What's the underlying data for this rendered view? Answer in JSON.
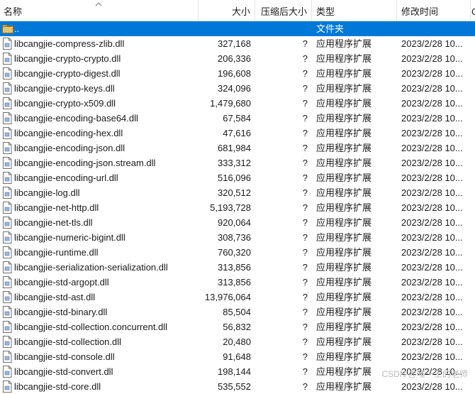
{
  "columns": {
    "name": "名称",
    "size": "大小",
    "packed": "压缩后大小",
    "type": "类型",
    "modified": "修改时间",
    "extra": "C"
  },
  "parent": {
    "name": "..",
    "type": "文件夹"
  },
  "files": [
    {
      "name": "libcangjie-compress-zlib.dll",
      "size": "327,168",
      "packed": "?",
      "type": "应用程序扩展",
      "modified": "2023/2/28 10..."
    },
    {
      "name": "libcangjie-crypto-crypto.dll",
      "size": "206,336",
      "packed": "?",
      "type": "应用程序扩展",
      "modified": "2023/2/28 10..."
    },
    {
      "name": "libcangjie-crypto-digest.dll",
      "size": "196,608",
      "packed": "?",
      "type": "应用程序扩展",
      "modified": "2023/2/28 10..."
    },
    {
      "name": "libcangjie-crypto-keys.dll",
      "size": "324,096",
      "packed": "?",
      "type": "应用程序扩展",
      "modified": "2023/2/28 10..."
    },
    {
      "name": "libcangjie-crypto-x509.dll",
      "size": "1,479,680",
      "packed": "?",
      "type": "应用程序扩展",
      "modified": "2023/2/28 10..."
    },
    {
      "name": "libcangjie-encoding-base64.dll",
      "size": "67,584",
      "packed": "?",
      "type": "应用程序扩展",
      "modified": "2023/2/28 10..."
    },
    {
      "name": "libcangjie-encoding-hex.dll",
      "size": "47,616",
      "packed": "?",
      "type": "应用程序扩展",
      "modified": "2023/2/28 10..."
    },
    {
      "name": "libcangjie-encoding-json.dll",
      "size": "681,984",
      "packed": "?",
      "type": "应用程序扩展",
      "modified": "2023/2/28 10..."
    },
    {
      "name": "libcangjie-encoding-json.stream.dll",
      "size": "333,312",
      "packed": "?",
      "type": "应用程序扩展",
      "modified": "2023/2/28 10..."
    },
    {
      "name": "libcangjie-encoding-url.dll",
      "size": "516,096",
      "packed": "?",
      "type": "应用程序扩展",
      "modified": "2023/2/28 10..."
    },
    {
      "name": "libcangjie-log.dll",
      "size": "320,512",
      "packed": "?",
      "type": "应用程序扩展",
      "modified": "2023/2/28 10..."
    },
    {
      "name": "libcangjie-net-http.dll",
      "size": "5,193,728",
      "packed": "?",
      "type": "应用程序扩展",
      "modified": "2023/2/28 10..."
    },
    {
      "name": "libcangjie-net-tls.dll",
      "size": "920,064",
      "packed": "?",
      "type": "应用程序扩展",
      "modified": "2023/2/28 10..."
    },
    {
      "name": "libcangjie-numeric-bigint.dll",
      "size": "308,736",
      "packed": "?",
      "type": "应用程序扩展",
      "modified": "2023/2/28 10..."
    },
    {
      "name": "libcangjie-runtime.dll",
      "size": "760,320",
      "packed": "?",
      "type": "应用程序扩展",
      "modified": "2023/2/28 10..."
    },
    {
      "name": "libcangjie-serialization-serialization.dll",
      "size": "313,856",
      "packed": "?",
      "type": "应用程序扩展",
      "modified": "2023/2/28 10..."
    },
    {
      "name": "libcangjie-std-argopt.dll",
      "size": "313,856",
      "packed": "?",
      "type": "应用程序扩展",
      "modified": "2023/2/28 10..."
    },
    {
      "name": "libcangjie-std-ast.dll",
      "size": "13,976,064",
      "packed": "?",
      "type": "应用程序扩展",
      "modified": "2023/2/28 10..."
    },
    {
      "name": "libcangjie-std-binary.dll",
      "size": "85,504",
      "packed": "?",
      "type": "应用程序扩展",
      "modified": "2023/2/28 10..."
    },
    {
      "name": "libcangjie-std-collection.concurrent.dll",
      "size": "56,832",
      "packed": "?",
      "type": "应用程序扩展",
      "modified": "2023/2/28 10..."
    },
    {
      "name": "libcangjie-std-collection.dll",
      "size": "20,480",
      "packed": "?",
      "type": "应用程序扩展",
      "modified": "2023/2/28 10..."
    },
    {
      "name": "libcangjie-std-console.dll",
      "size": "91,648",
      "packed": "?",
      "type": "应用程序扩展",
      "modified": "2023/2/28 10..."
    },
    {
      "name": "libcangjie-std-convert.dll",
      "size": "198,144",
      "packed": "?",
      "type": "应用程序扩展",
      "modified": "2023/2/28 10..."
    },
    {
      "name": "libcangjie-std-core.dll",
      "size": "535,552",
      "packed": "?",
      "type": "应用程序扩展",
      "modified": "2023/2/28 10..."
    }
  ],
  "watermark": "CSDN @唯一王的老师",
  "colors": {
    "selection": "#0078d7",
    "folder": "#c8a14a"
  }
}
